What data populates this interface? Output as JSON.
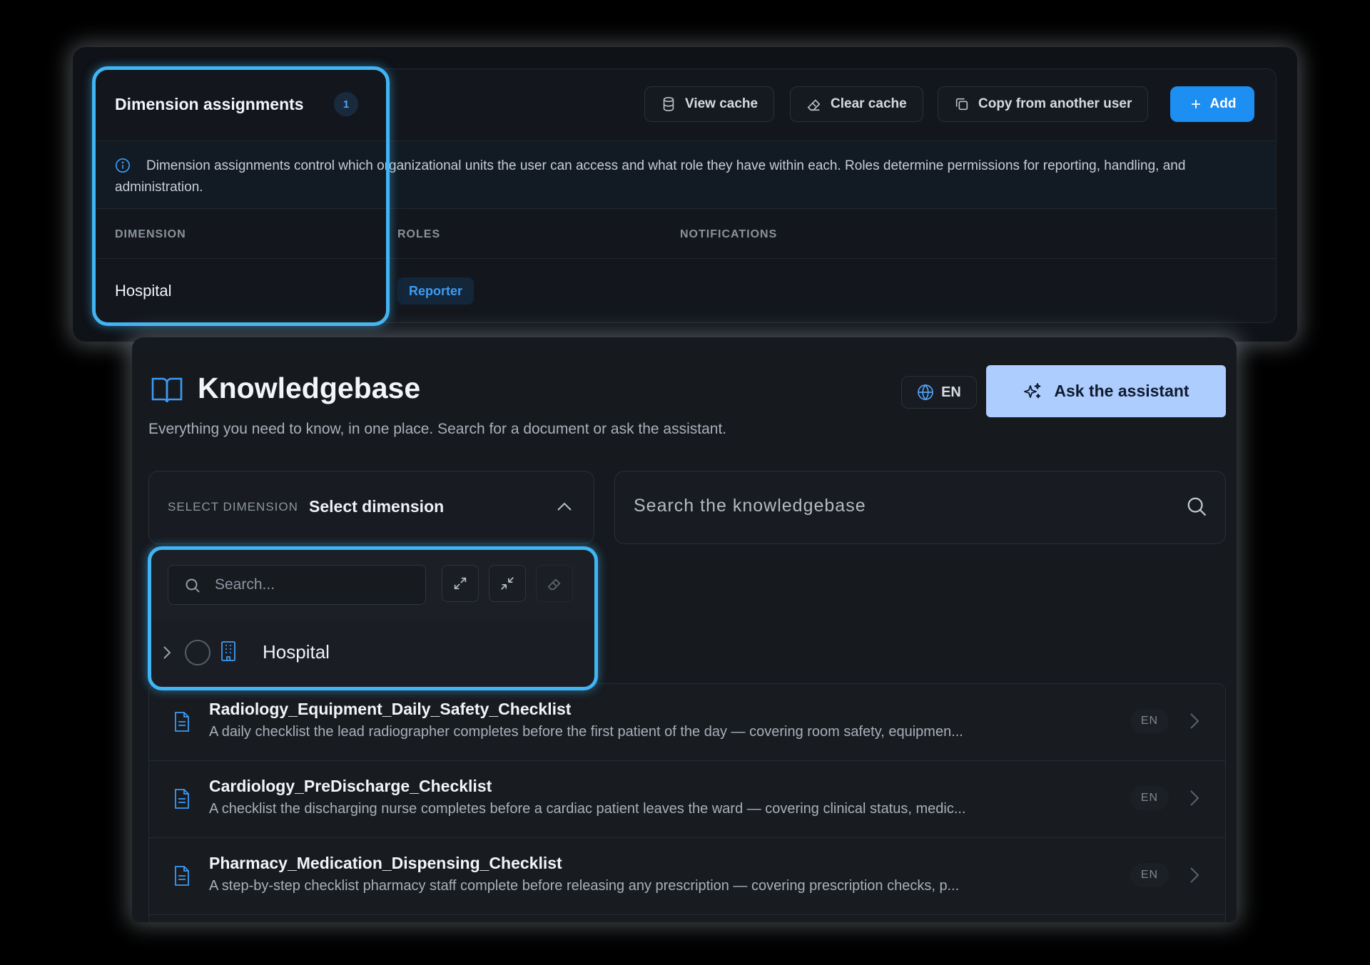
{
  "dimension_assignments": {
    "title": "Dimension assignments",
    "count": "1",
    "buttons": {
      "view_cache": "View cache",
      "clear_cache": "Clear cache",
      "copy_from_user": "Copy from another user",
      "add": "Add"
    },
    "info_text": "Dimension assignments control which organizational units the user can access and what role they have within each. Roles determine permissions for reporting, handling, and administration.",
    "columns": [
      "DIMENSION",
      "ROLES",
      "NOTIFICATIONS"
    ],
    "rows": [
      {
        "dimension": "Hospital",
        "role": "Reporter"
      }
    ]
  },
  "knowledgebase": {
    "title": "Knowledgebase",
    "subtitle": "Everything you need to know, in one place. Search for a document or ask the assistant.",
    "language": "EN",
    "ask_button": "Ask the assistant",
    "dimension_select": {
      "label": "SELECT DIMENSION",
      "value": "Select dimension"
    },
    "search_placeholder": "Search the knowledgebase",
    "dropdown": {
      "search_placeholder": "Search...",
      "tree_items": [
        {
          "label": "Hospital"
        }
      ]
    },
    "documents": [
      {
        "title": "Radiology_Equipment_Daily_Safety_Checklist",
        "description": "A daily checklist the lead radiographer completes before the first patient of the day — covering room safety, equipmen...",
        "lang": "EN"
      },
      {
        "title": "Cardiology_PreDischarge_Checklist",
        "description": "A checklist the discharging nurse completes before a cardiac patient leaves the ward — covering clinical status, medic...",
        "lang": "EN"
      },
      {
        "title": "Pharmacy_Medication_Dispensing_Checklist",
        "description": "A step-by-step checklist pharmacy staff complete before releasing any prescription — covering prescription checks, p...",
        "lang": "EN"
      }
    ]
  },
  "colors": {
    "accent": "#1d8ef2",
    "highlight": "#41b4f3",
    "ask_button_bg": "#aecdff"
  }
}
